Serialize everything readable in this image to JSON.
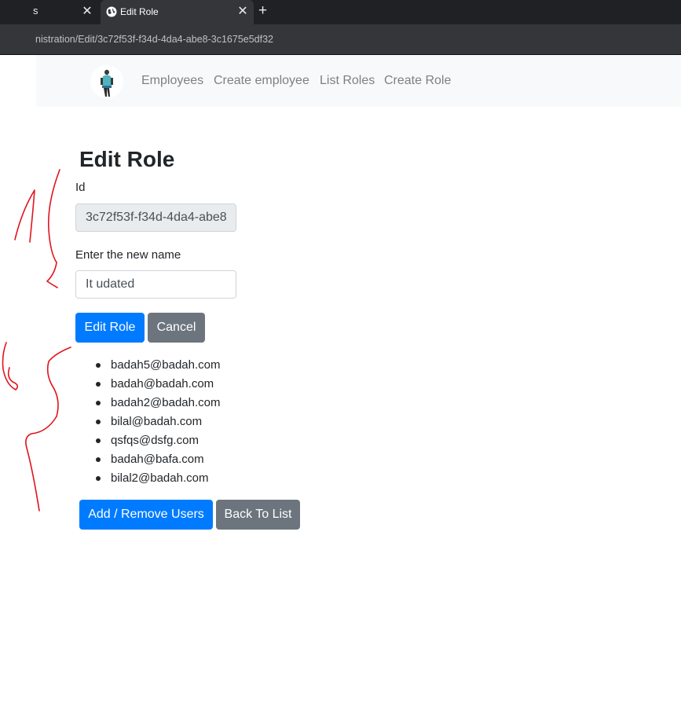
{
  "browser": {
    "previous_tab_partial": "s",
    "active_tab_title": "Edit Role",
    "new_tab_symbol": "+",
    "close_symbol": "✕",
    "url": "nistration/Edit/3c72f53f-f34d-4da4-abe8-3c1675e5df32"
  },
  "nav": {
    "links": [
      "Employees",
      "Create employee",
      "List Roles",
      "Create Role"
    ]
  },
  "form": {
    "title": "Edit Role",
    "id_label": "Id",
    "id_value": "3c72f53f-f34d-4da4-abe8",
    "name_label": "Enter the new name",
    "name_value": "It udated",
    "submit_label": "Edit Role",
    "cancel_label": "Cancel"
  },
  "users": [
    "badah5@badah.com",
    "badah@badah.com",
    "badah2@badah.com",
    "bilal@badah.com",
    "qsfqs@dsfg.com",
    "badah@bafa.com",
    "bilal2@badah.com"
  ],
  "actions": {
    "add_remove_label": "Add / Remove Users",
    "back_label": "Back To List"
  },
  "colors": {
    "primary": "#007bff",
    "secondary": "#6c757d",
    "annotation_ink": "#e0141c"
  }
}
